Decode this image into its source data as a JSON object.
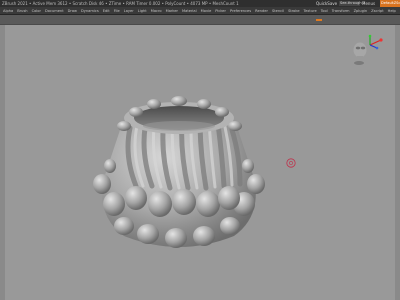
{
  "titlebar": {
    "status": "ZBrush 2021 • Active Mem 3612 • Scratch Disk 46 • ZTime • RAM Timer 0.002 • PolyCount • 4073 MP • MeshCount 1",
    "quicksave": "QuickSave",
    "see_through": "See-through 0",
    "menus": "Menus",
    "default_script": "DefaultZScript"
  },
  "menus": [
    "Alpha",
    "Brush",
    "Color",
    "Document",
    "Draw",
    "Dynamics",
    "Edit",
    "File",
    "Layer",
    "Light",
    "Macro",
    "Marker",
    "Material",
    "Movie",
    "Picker",
    "Preferences",
    "Render",
    "Stencil",
    "Stroke",
    "Texture",
    "Tool",
    "Transform",
    "Zplugin",
    "Zscript",
    "Help"
  ],
  "colors": {
    "accent": "#e07a1f",
    "viewport_bg": "#999999",
    "model": "#b8b8b8"
  },
  "icons": {
    "nav": "navigation-gizmo-icon",
    "cursor": "brush-cursor-icon"
  }
}
